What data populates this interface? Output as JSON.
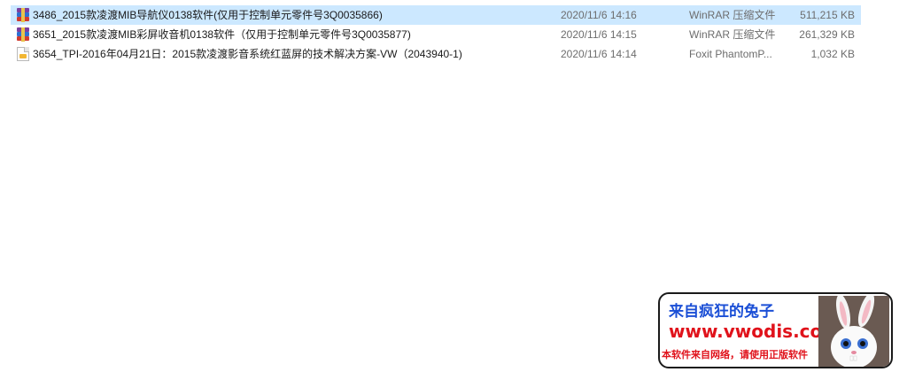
{
  "files": [
    {
      "name": "3486_2015款凌渡MIB导航仪0138软件(仅用于控制单元零件号3Q0035866)",
      "date": "2020/11/6 14:16",
      "type": "WinRAR 压缩文件",
      "size": "511,215 KB",
      "icon": "winrar-archive-icon",
      "selected": true
    },
    {
      "name": "3651_2015款凌渡MIB彩屏收音机0138软件（仅用于控制单元零件号3Q0035877)",
      "date": "2020/11/6 14:15",
      "type": "WinRAR 压缩文件",
      "size": "261,329 KB",
      "icon": "winrar-archive-icon",
      "selected": false
    },
    {
      "name": "3654_TPI-2016年04月21日：2015款凌渡影音系统红蓝屏的技术解决方案-VW（2043940-1)",
      "date": "2020/11/6 14:14",
      "type": "Foxit PhantomP...",
      "size": "1,032 KB",
      "icon": "pdf-document-icon",
      "selected": false
    }
  ],
  "watermark": {
    "line1": "来自疯狂的兔子",
    "line2": "www.vwodis.com",
    "line3": "本软件来自网络，请使用正版软件",
    "colors": {
      "line1": "#1b4fd6",
      "line2_3": "#e0121b"
    }
  },
  "colors": {
    "selection": "#cce8ff",
    "secondary_text": "#6d6d6d"
  }
}
